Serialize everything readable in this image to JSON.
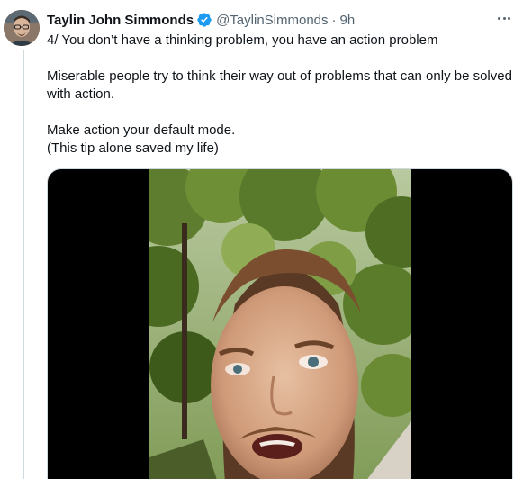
{
  "tweet": {
    "author_name": "Taylin John Simmonds",
    "handle": "@TaylinSimmonds",
    "separator": "·",
    "timestamp": "9h",
    "text_lines": [
      "4/ You don’t have a thinking problem, you have an action problem",
      "",
      "Miserable people try to think their way out of problems that can only be solved with action.",
      "",
      "Make action your default mode.",
      "(This tip alone saved my life)"
    ]
  },
  "icons": {
    "verified": "verified-badge-icon",
    "more": "more-options-icon"
  },
  "colors": {
    "verified_blue": "#1d9bf0",
    "secondary_text": "#536471",
    "thread_line": "#cfd9de"
  }
}
